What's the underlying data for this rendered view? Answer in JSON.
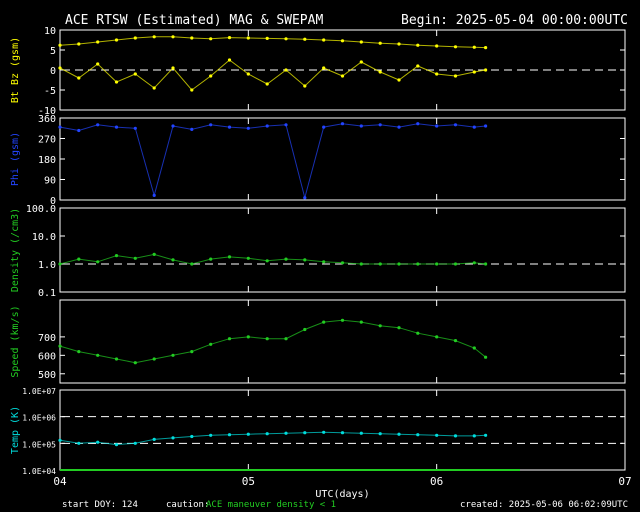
{
  "header": {
    "title": "ACE RTSW (Estimated) MAG & SWEPAM",
    "begin": "Begin: 2025-05-04 00:00:00UTC"
  },
  "footer": {
    "start_doy": "start DOY: 124",
    "caution_label": "caution:",
    "caution_text": "ACE maneuver  density < 1",
    "created": "created: 2025-05-06 06:02:09UTC"
  },
  "colors": {
    "bt": "#ffff00",
    "bz": "#ffff00",
    "phi": "#2244ff",
    "density": "#22cc22",
    "speed": "#22cc22",
    "temp": "#00dddd",
    "caution_bar": "#22cc22"
  },
  "chart_data": [
    {
      "type": "scatter",
      "ylabel": "Bt Bz (gsm)",
      "ylim": [
        -10,
        10
      ],
      "yticks": [
        "10",
        "5",
        "0",
        "-5",
        "-10"
      ],
      "dashed_lines": [
        0
      ],
      "series": [
        {
          "key": "bt",
          "points": [
            [
              0.0,
              6.2
            ],
            [
              0.1,
              6.5
            ],
            [
              0.2,
              7.0
            ],
            [
              0.3,
              7.5
            ],
            [
              0.4,
              8.0
            ],
            [
              0.5,
              8.3
            ],
            [
              0.6,
              8.3
            ],
            [
              0.7,
              8.0
            ],
            [
              0.8,
              7.8
            ],
            [
              0.9,
              8.1
            ],
            [
              1.0,
              8.0
            ],
            [
              1.1,
              7.9
            ],
            [
              1.2,
              7.8
            ],
            [
              1.3,
              7.7
            ],
            [
              1.4,
              7.5
            ],
            [
              1.5,
              7.3
            ],
            [
              1.6,
              7.0
            ],
            [
              1.7,
              6.7
            ],
            [
              1.8,
              6.5
            ],
            [
              1.9,
              6.2
            ],
            [
              2.0,
              6.0
            ],
            [
              2.1,
              5.8
            ],
            [
              2.2,
              5.7
            ],
            [
              2.26,
              5.6
            ]
          ]
        },
        {
          "key": "bz",
          "points": [
            [
              0.0,
              0.5
            ],
            [
              0.1,
              -2.0
            ],
            [
              0.2,
              1.5
            ],
            [
              0.3,
              -3.0
            ],
            [
              0.4,
              -1.0
            ],
            [
              0.5,
              -4.5
            ],
            [
              0.6,
              0.5
            ],
            [
              0.7,
              -5.0
            ],
            [
              0.8,
              -1.5
            ],
            [
              0.9,
              2.5
            ],
            [
              1.0,
              -1.0
            ],
            [
              1.1,
              -3.5
            ],
            [
              1.2,
              0.0
            ],
            [
              1.3,
              -4.0
            ],
            [
              1.4,
              0.5
            ],
            [
              1.5,
              -1.5
            ],
            [
              1.6,
              2.0
            ],
            [
              1.7,
              -0.5
            ],
            [
              1.8,
              -2.5
            ],
            [
              1.9,
              1.0
            ],
            [
              2.0,
              -1.0
            ],
            [
              2.1,
              -1.5
            ],
            [
              2.2,
              -0.5
            ],
            [
              2.26,
              0.0
            ]
          ]
        }
      ]
    },
    {
      "type": "scatter",
      "ylabel": "Phi (gsm)",
      "ylim": [
        0,
        360
      ],
      "yticks": [
        "360",
        "270",
        "180",
        "90",
        "0"
      ],
      "dashed_lines": [],
      "series": [
        {
          "key": "phi",
          "points": [
            [
              0.0,
              320
            ],
            [
              0.1,
              305
            ],
            [
              0.2,
              330
            ],
            [
              0.3,
              320
            ],
            [
              0.4,
              315
            ],
            [
              0.5,
              20
            ],
            [
              0.6,
              325
            ],
            [
              0.7,
              310
            ],
            [
              0.8,
              330
            ],
            [
              0.9,
              320
            ],
            [
              1.0,
              315
            ],
            [
              1.1,
              325
            ],
            [
              1.2,
              330
            ],
            [
              1.3,
              10
            ],
            [
              1.4,
              320
            ],
            [
              1.5,
              335
            ],
            [
              1.6,
              325
            ],
            [
              1.7,
              330
            ],
            [
              1.8,
              320
            ],
            [
              1.9,
              335
            ],
            [
              2.0,
              325
            ],
            [
              2.1,
              330
            ],
            [
              2.2,
              320
            ],
            [
              2.26,
              325
            ]
          ]
        }
      ]
    },
    {
      "type": "scatter",
      "ylabel": "Density (/cm3)",
      "yscale": "log",
      "ylim": [
        0.1,
        100
      ],
      "yticks": [
        "100.0",
        "10.0",
        "1.0",
        "0.1"
      ],
      "dashed_lines": [
        1.0
      ],
      "series": [
        {
          "key": "density",
          "points": [
            [
              0.0,
              1.0
            ],
            [
              0.1,
              1.5
            ],
            [
              0.2,
              1.2
            ],
            [
              0.3,
              2.0
            ],
            [
              0.4,
              1.6
            ],
            [
              0.5,
              2.2
            ],
            [
              0.6,
              1.4
            ],
            [
              0.7,
              1.0
            ],
            [
              0.8,
              1.5
            ],
            [
              0.9,
              1.8
            ],
            [
              1.0,
              1.6
            ],
            [
              1.1,
              1.3
            ],
            [
              1.2,
              1.5
            ],
            [
              1.3,
              1.4
            ],
            [
              1.4,
              1.2
            ],
            [
              1.5,
              1.1
            ],
            [
              1.6,
              1.0
            ],
            [
              1.7,
              1.0
            ],
            [
              1.8,
              1.0
            ],
            [
              1.9,
              1.0
            ],
            [
              2.0,
              1.0
            ],
            [
              2.1,
              1.0
            ],
            [
              2.2,
              1.1
            ],
            [
              2.26,
              1.0
            ]
          ]
        }
      ]
    },
    {
      "type": "scatter",
      "ylabel": "Speed (km/s)",
      "ylim": [
        450,
        900
      ],
      "yticks": [
        "700",
        "600",
        "500"
      ],
      "dashed_lines": [],
      "series": [
        {
          "key": "speed",
          "points": [
            [
              0.0,
              650
            ],
            [
              0.1,
              620
            ],
            [
              0.2,
              600
            ],
            [
              0.3,
              580
            ],
            [
              0.4,
              560
            ],
            [
              0.5,
              580
            ],
            [
              0.6,
              600
            ],
            [
              0.7,
              620
            ],
            [
              0.8,
              660
            ],
            [
              0.9,
              690
            ],
            [
              1.0,
              700
            ],
            [
              1.1,
              690
            ],
            [
              1.2,
              690
            ],
            [
              1.3,
              740
            ],
            [
              1.4,
              780
            ],
            [
              1.5,
              790
            ],
            [
              1.6,
              780
            ],
            [
              1.7,
              760
            ],
            [
              1.8,
              750
            ],
            [
              1.9,
              720
            ],
            [
              2.0,
              700
            ],
            [
              2.1,
              680
            ],
            [
              2.2,
              640
            ],
            [
              2.26,
              590
            ]
          ]
        }
      ]
    },
    {
      "type": "scatter",
      "ylabel": "Temp (K)",
      "yscale": "log",
      "ylim": [
        10000,
        10000000
      ],
      "yticks": [
        "1.0E+07",
        "1.0E+06",
        "1.0E+05",
        "1.0E+04"
      ],
      "dashed_lines": [
        1000000,
        100000
      ],
      "series": [
        {
          "key": "temp",
          "points": [
            [
              0.0,
              130000
            ],
            [
              0.1,
              100000
            ],
            [
              0.2,
              110000
            ],
            [
              0.3,
              90000
            ],
            [
              0.4,
              100000
            ],
            [
              0.5,
              140000
            ],
            [
              0.6,
              160000
            ],
            [
              0.7,
              180000
            ],
            [
              0.8,
              200000
            ],
            [
              0.9,
              210000
            ],
            [
              1.0,
              220000
            ],
            [
              1.1,
              230000
            ],
            [
              1.2,
              240000
            ],
            [
              1.3,
              250000
            ],
            [
              1.4,
              260000
            ],
            [
              1.5,
              250000
            ],
            [
              1.6,
              240000
            ],
            [
              1.7,
              230000
            ],
            [
              1.8,
              220000
            ],
            [
              1.9,
              210000
            ],
            [
              2.0,
              200000
            ],
            [
              2.1,
              190000
            ],
            [
              2.2,
              190000
            ],
            [
              2.26,
              200000
            ]
          ]
        }
      ]
    }
  ],
  "x_axis": {
    "label": "UTC(days)",
    "range": [
      0,
      3
    ],
    "ticks": [
      {
        "value": 0,
        "label": "04"
      },
      {
        "value": 1,
        "label": "05"
      },
      {
        "value": 2,
        "label": "06"
      },
      {
        "value": 3,
        "label": "07"
      }
    ]
  }
}
